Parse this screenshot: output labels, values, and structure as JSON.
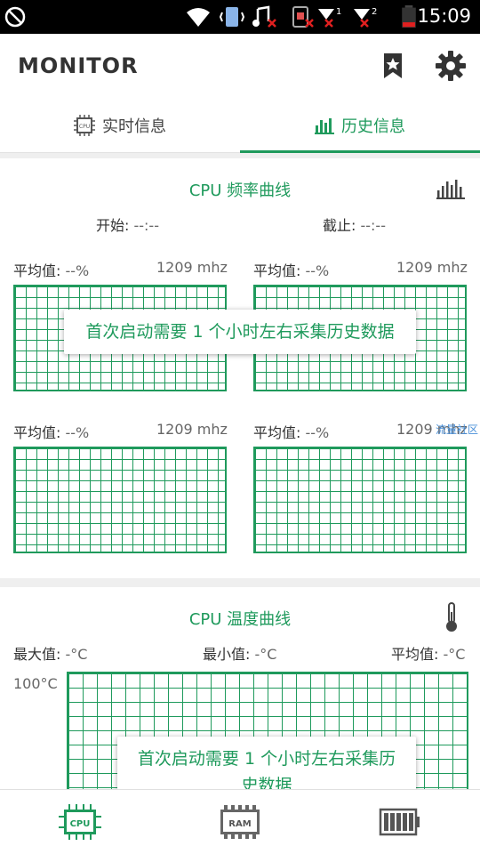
{
  "status_bar": {
    "time": "15:09"
  },
  "app_bar": {
    "title": "MONITOR"
  },
  "tabs": [
    {
      "label": "实时信息",
      "active": false
    },
    {
      "label": "历史信息",
      "active": true
    }
  ],
  "cpu_freq": {
    "title": "CPU 频率曲线",
    "start_label": "开始:",
    "start_value": " --:--",
    "end_label": "截止:",
    "end_value": " --:--",
    "cores": [
      {
        "avg_label": "平均值:",
        "avg_value": " --%",
        "freq": "1209 mhz"
      },
      {
        "avg_label": "平均值:",
        "avg_value": " --%",
        "freq": "1209 mhz"
      },
      {
        "avg_label": "平均值:",
        "avg_value": " --%",
        "freq": "1209 mhz"
      },
      {
        "avg_label": "平均值:",
        "avg_value": " --%",
        "freq": "1209 mhz"
      }
    ],
    "toast": "首次启动需要 1 个小时左右采集历史数据",
    "overlay_link": "流量社区"
  },
  "cpu_temp": {
    "title": "CPU 温度曲线",
    "max_label": "最大值:",
    "max_value": " -°C",
    "min_label": "最小值:",
    "min_value": " -°C",
    "avg_label": "平均值:",
    "avg_value": " -°C",
    "y_label": "100°C",
    "toast": "首次启动需要 1 个小时左右采集历史数据"
  },
  "bottom_nav": [
    {
      "label": "CPU",
      "active": true
    },
    {
      "label": "RAM",
      "active": false
    },
    {
      "label": "",
      "active": false
    }
  ],
  "colors": {
    "accent": "#1f9a5c",
    "text_dark": "#333333",
    "link": "#4a90d9"
  }
}
